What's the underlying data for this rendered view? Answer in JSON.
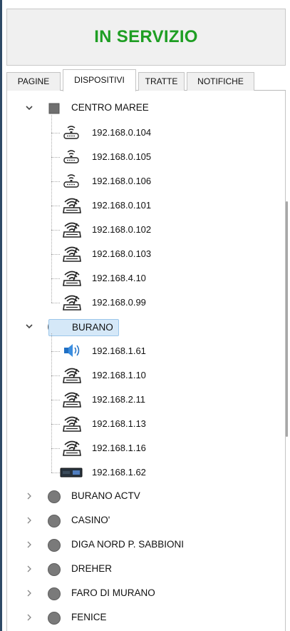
{
  "status": {
    "text": "IN SERVIZIO",
    "color": "#1e9e23"
  },
  "tabs": [
    {
      "label": "PAGINE",
      "active": false
    },
    {
      "label": "DISPOSITIVI",
      "active": true
    },
    {
      "label": "TRATTE",
      "active": false
    },
    {
      "label": "NOTIFICHE",
      "active": false
    }
  ],
  "tree": {
    "groups": [
      {
        "label": "CENTRO MAREE",
        "expanded": true,
        "icon": "gray-square-icon",
        "children": [
          {
            "label": "192.168.0.104",
            "icon": "network-device-icon"
          },
          {
            "label": "192.168.0.105",
            "icon": "network-device-icon"
          },
          {
            "label": "192.168.0.106",
            "icon": "network-device-icon"
          },
          {
            "label": "192.168.0.101",
            "icon": "wifi-router-icon"
          },
          {
            "label": "192.168.0.102",
            "icon": "wifi-router-icon"
          },
          {
            "label": "192.168.0.103",
            "icon": "wifi-router-icon"
          },
          {
            "label": "192.168.4.10",
            "icon": "wifi-router-icon"
          },
          {
            "label": "192.168.0.99",
            "icon": "wifi-router-icon"
          }
        ]
      },
      {
        "label": "BURANO",
        "expanded": true,
        "selected": true,
        "icon": "gray-circle-icon",
        "children": [
          {
            "label": "192.168.1.61",
            "icon": "speaker-icon"
          },
          {
            "label": "192.168.1.10",
            "icon": "wifi-router-icon"
          },
          {
            "label": "192.168.2.11",
            "icon": "wifi-router-icon"
          },
          {
            "label": "192.168.1.13",
            "icon": "wifi-router-icon"
          },
          {
            "label": "192.168.1.16",
            "icon": "wifi-router-icon"
          },
          {
            "label": "192.168.1.62",
            "icon": "display-panel-icon"
          }
        ]
      },
      {
        "label": "BURANO ACTV",
        "expanded": false,
        "icon": "gray-circle-icon"
      },
      {
        "label": "CASINO'",
        "expanded": false,
        "icon": "gray-circle-icon"
      },
      {
        "label": "DIGA NORD P. SABBIONI",
        "expanded": false,
        "icon": "gray-circle-icon"
      },
      {
        "label": "DREHER",
        "expanded": false,
        "icon": "gray-circle-icon"
      },
      {
        "label": "FARO DI MURANO",
        "expanded": false,
        "icon": "gray-circle-icon"
      },
      {
        "label": "FENICE",
        "expanded": false,
        "icon": "gray-circle-icon"
      }
    ]
  }
}
